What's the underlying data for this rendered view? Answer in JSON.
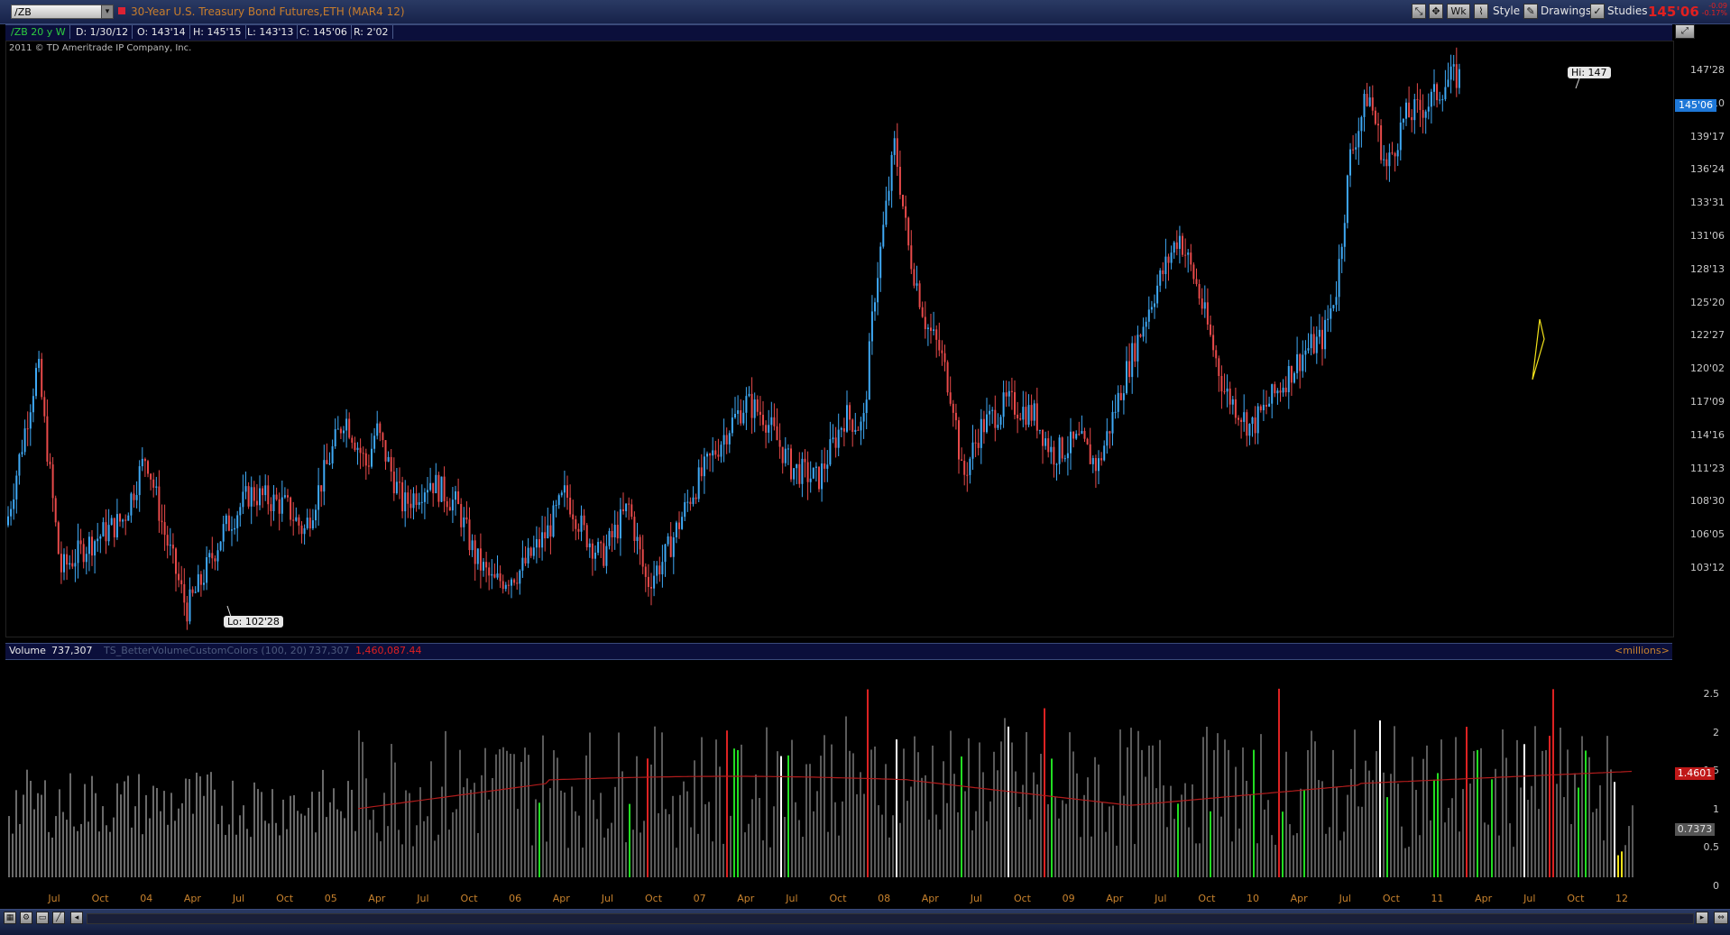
{
  "header": {
    "symbol": "/ZB",
    "description": "30-Year U.S. Treasury Bond Futures,ETH (MAR4 12)",
    "aggregation": "Wk",
    "style_label": "Style",
    "drawings_label": "Drawings",
    "studies_label": "Studies",
    "last_price": "145'06",
    "change": "-0.09",
    "change_pct": "-0.17%"
  },
  "infobar": {
    "chart_id": "/ZB 20 y W",
    "date": "D: 1/30/12",
    "open": "O: 143'14",
    "high": "H: 145'15",
    "low": "L: 143'13",
    "close": "C: 145'06",
    "range": "R: 2'02"
  },
  "copyright": "2011 © TD Ameritrade IP Company, Inc.",
  "annotations": {
    "hi": "Hi: 147",
    "lo": "Lo: 102'28"
  },
  "price_axis": {
    "ticks": [
      "147'28",
      "145'06",
      "142'10",
      "139'17",
      "136'24",
      "133'31",
      "131'06",
      "128'13",
      "125'20",
      "122'27",
      "120'02",
      "117'09",
      "114'16",
      "111'23",
      "108'30",
      "106'05",
      "103'12"
    ],
    "current": "145'06"
  },
  "volume_panel": {
    "title": "Volume",
    "value": "737,307",
    "study": "TS_BetterVolumeCustomColors (100, 20)",
    "study_value": "737,307",
    "ma_value": "1,460,087.44",
    "units": "<millions>",
    "ticks": [
      "2.5",
      "2",
      "1.5",
      "1",
      "0.5",
      "0"
    ],
    "ma_label": "1.4601",
    "vol_label": "0.7373"
  },
  "date_axis": {
    "labels": [
      "Jul",
      "Oct",
      "04",
      "Apr",
      "Jul",
      "Oct",
      "05",
      "Apr",
      "Jul",
      "Oct",
      "06",
      "Apr",
      "Jul",
      "Oct",
      "07",
      "Apr",
      "Jul",
      "Oct",
      "08",
      "Apr",
      "Jul",
      "Oct",
      "09",
      "Apr",
      "Jul",
      "Oct",
      "10",
      "Apr",
      "Jul",
      "Oct",
      "11",
      "Apr",
      "Jul",
      "Oct",
      "12"
    ]
  },
  "colors": {
    "up": "#3fa9f5",
    "down": "#e84a4a",
    "volume_default": "#5a5a5a",
    "volume_green": "#22dd22",
    "volume_red": "#dd2222",
    "volume_white": "#ffffff",
    "volume_yellow": "#f2e21a",
    "ma_line": "#b01c1c"
  }
}
